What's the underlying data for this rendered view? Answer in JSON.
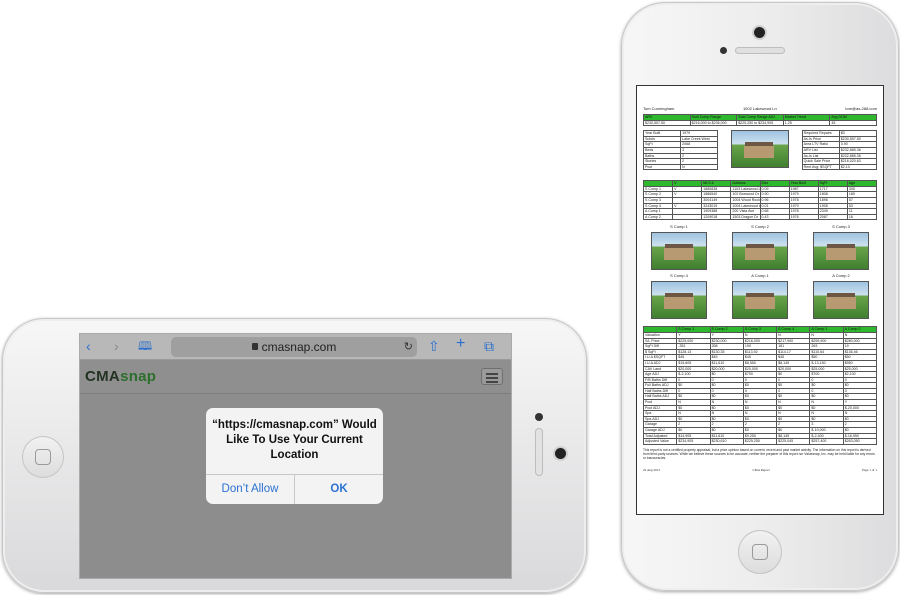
{
  "landscape_phone": {
    "safari": {
      "url": "cmasnap.com",
      "icons": [
        "back-icon",
        "forward-icon",
        "bookmarks-icon",
        "lock-icon",
        "reload-icon",
        "share-icon",
        "new-tab-icon",
        "tabs-icon"
      ]
    },
    "site": {
      "logo_part1": "CMA",
      "logo_part2": "snap"
    },
    "alert": {
      "message": "“https://cmasnap.com” Would Like To Use Your Current Location",
      "deny_label": "Don’t Allow",
      "allow_label": "OK"
    }
  },
  "portrait_phone": {
    "report": {
      "agent": "Tom Cunningham",
      "address": "1002 Lakewood Ln",
      "email": "tom@as-288.com",
      "summary_headers": [
        "ARV",
        "Sold Comp Range",
        "Sold Comp Range ADJ",
        "Market Trend",
        "Avg DOM"
      ],
      "summary_values": [
        "$230,557.50",
        "$216,000 to $236,000",
        "$225,250 to $234,905",
        "1.25",
        "45"
      ],
      "details": [
        [
          "Year Built",
          "1979"
        ],
        [
          "Subdv",
          "Lake Creek West"
        ],
        [
          "SqFt",
          "2068"
        ],
        [
          "Beds",
          "3"
        ],
        [
          "Baths",
          "2"
        ],
        [
          "Stories",
          "2"
        ],
        [
          "Pool",
          "N"
        ]
      ],
      "financials": [
        [
          "Required Repairs",
          "$0"
        ],
        [
          "As-Is Price",
          "$230,557.50"
        ],
        [
          "Area LTV Ratio",
          "0.90"
        ],
        [
          "ARV List",
          "$232,885.36"
        ],
        [
          "As-Is List",
          "$232,885.36"
        ],
        [
          "Quick Sale Price",
          "$216,020.63"
        ],
        [
          "Rent Avg: $SQFT",
          "$2.10"
        ]
      ],
      "comp_headers": [
        "",
        "V",
        "MLS #",
        "Address",
        "Dist",
        "Year Built",
        "SqFt",
        "Age"
      ],
      "comp_rows": [
        [
          "S Comp 1",
          "V",
          "1885838",
          "1103 Lakewood Ln",
          "0.09",
          "1987",
          "1717",
          "305"
        ],
        [
          "S Comp 2",
          "V",
          "1886540",
          "102 Boxwood Dr",
          "0.90",
          "1979",
          "1808",
          "189"
        ],
        [
          "S Comp 3",
          "",
          "3004149",
          "1004 Wood Rock Dr",
          "0.96",
          "1978",
          "1896",
          "57"
        ],
        [
          "S Comp 4",
          "V",
          "3243019",
          "1004 Lakewood Ln",
          "0.01",
          "1979",
          "1905",
          "53"
        ],
        [
          "A Comp 1",
          "",
          "1909388",
          "200 Vista Ave",
          "0.68",
          "1978",
          "2349",
          "11"
        ],
        [
          "A Comp 2",
          "",
          "1209018",
          "1503 Dragon Dr",
          "0.43",
          "1976",
          "2067",
          "16"
        ]
      ],
      "photo_labels": [
        "S Comp 1",
        "S Comp 2",
        "S Comp 3",
        "S Comp 4",
        "A Comp 1",
        "A Comp 2"
      ],
      "adj_headers": [
        "",
        "S Comp 1",
        "S Comp 2",
        "S Comp 3",
        "S Comp 4",
        "A Comp 1",
        "A Comp 2"
      ],
      "adj_rows": [
        [
          "Valuation",
          "Y",
          "Y",
          "N",
          "N",
          "N",
          "N"
        ],
        [
          "S/L Price",
          "$225,000",
          "$230,000",
          "$216,000",
          "$217,900",
          "$259,900",
          "$280,000"
        ],
        [
          "SqFt Diff",
          "-351",
          "258",
          "190",
          "181",
          "263",
          "19"
        ],
        [
          "$ SqFt",
          "$128.13",
          "$130.35",
          "$113.92",
          "$114.17",
          "$110.64",
          "$136.46"
        ],
        [
          "I.U.A $SQFT",
          "$45",
          "$45",
          "$45",
          "$45",
          "$50",
          "$50"
        ],
        [
          "I.U.A ADJ",
          "$15,605",
          "$11,610",
          "$8,550",
          "$8,145",
          "$-13,150",
          "$950"
        ],
        [
          "CAV Land",
          "$20,000",
          "$20,000",
          "$20,000",
          "$20,000",
          "$25,000",
          "$25,000"
        ],
        [
          "Age ADJ",
          "$-2,100",
          "$0",
          "$700",
          "$0",
          "$700",
          "$2,100"
        ],
        [
          "F/B Baths Diff",
          "0",
          "0",
          "0",
          "0",
          "0",
          "0"
        ],
        [
          "Full Baths ADJ",
          "$0",
          "$0",
          "$0",
          "$0",
          "$0",
          "$0"
        ],
        [
          "Half Baths Diff",
          "0",
          "0",
          "0",
          "0",
          "0",
          "0"
        ],
        [
          "Half Baths ADJ",
          "$0",
          "$0",
          "$0",
          "$0",
          "$0",
          "$0"
        ],
        [
          "Pool",
          "N",
          "N",
          "N",
          "N",
          "N",
          "Y"
        ],
        [
          "Pool ADJ",
          "$0",
          "$0",
          "$0",
          "$0",
          "$0",
          "$-20,000"
        ],
        [
          "Spa",
          "N",
          "N",
          "N",
          "N",
          "N",
          "N"
        ],
        [
          "Spa ADJ",
          "$0",
          "$0",
          "$0",
          "$0",
          "$0",
          "$0"
        ],
        [
          "Garage",
          "2",
          "2",
          "2",
          "2",
          "3",
          "2"
        ],
        [
          "Garage ADJ",
          "$0",
          "$0",
          "$0",
          "$0",
          "$-10,000",
          "$0"
        ],
        [
          "Total Adjusted",
          "$14,905",
          "$11,610",
          "$9,250",
          "$8,145",
          "$-2,400",
          "$-16,950"
        ],
        [
          "Adjusted Value",
          "$234,905",
          "$230,610",
          "$225,250",
          "$225,045",
          "$257,400",
          "$263,050"
        ]
      ],
      "disclaimer": "This report is not a certified property appraisal, but a price opinion based on current, recent and past market activity. The information on this report is derived from third-party sources. While we believe these sources to be accurate, neither the preparer of this report nor Valuesnap, Inc. may be held liable for any errors or inaccuracies.",
      "footer_date": "22 Aug 2013",
      "footer_title": "CMA Report",
      "footer_page": "Page 1 of 1"
    }
  },
  "colors": {
    "accent_green": "#2db82d",
    "link_blue": "#2b72d4",
    "overlay_gray": "#8d8d8d"
  }
}
